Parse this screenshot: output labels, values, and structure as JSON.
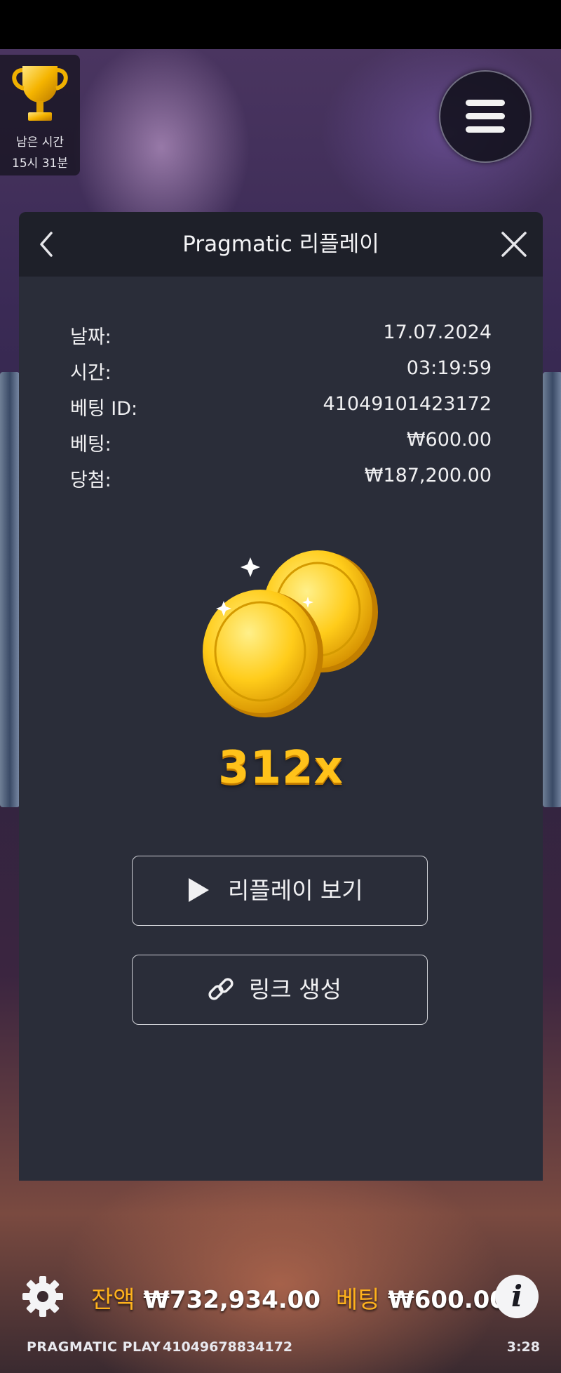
{
  "hud": {
    "trophy_label": "남은 시간",
    "trophy_time": "15시 31분"
  },
  "replay_panel": {
    "title": "Pragmatic 리플레이",
    "details": [
      {
        "label": "날짜:",
        "value": "17.07.2024"
      },
      {
        "label": "시간:",
        "value": "03:19:59"
      },
      {
        "label": "베팅 ID:",
        "value": "41049101423172"
      },
      {
        "label": "베팅:",
        "value": "₩600.00"
      },
      {
        "label": "당첨:",
        "value": "₩187,200.00"
      }
    ],
    "multiplier": "312x",
    "watch_replay_label": "리플레이 보기",
    "create_link_label": "링크 생성"
  },
  "bottom_bar": {
    "balance_label": "잔액",
    "balance_value": "₩732,934.00",
    "bet_label": "베팅",
    "bet_value": "₩600.00"
  },
  "footer": {
    "brand": "PRAGMATIC PLAY",
    "round_id": "41049678834172",
    "clock": "3:28"
  },
  "colors": {
    "panel_bg": "#2a2d39",
    "panel_header_bg": "#1e2029",
    "accent_gold": "#ffc21a",
    "label_orange": "#ffb21c"
  },
  "icons": [
    "trophy-icon",
    "menu-icon",
    "back-icon",
    "close-icon",
    "coins-icon",
    "play-icon",
    "link-icon",
    "gear-icon",
    "info-icon"
  ]
}
